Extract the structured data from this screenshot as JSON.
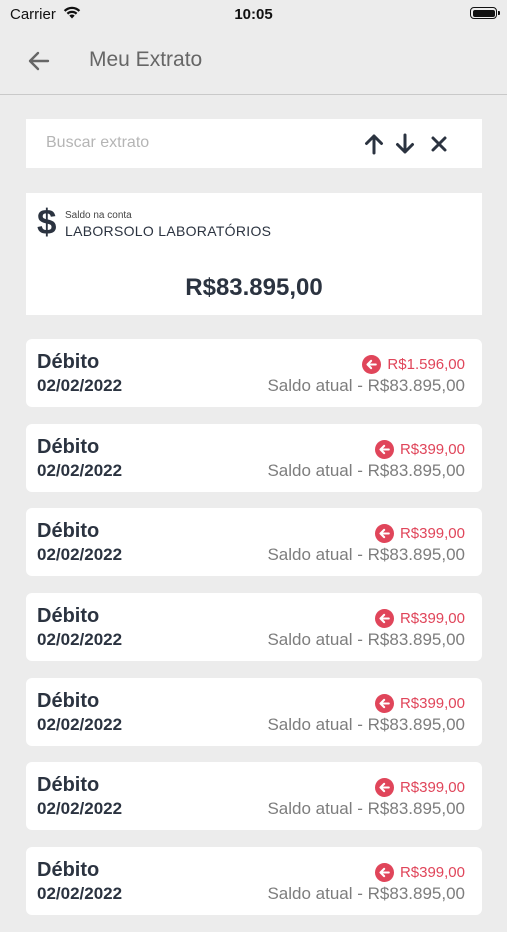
{
  "status_bar": {
    "carrier": "Carrier",
    "time": "10:05"
  },
  "header": {
    "title": "Meu Extrato"
  },
  "search": {
    "placeholder": "Buscar extrato"
  },
  "balance": {
    "caption": "Saldo na conta",
    "company": "LABORSOLO LABORATÓRIOS",
    "amount": "R$83.895,00"
  },
  "transactions": [
    {
      "type": "Débito",
      "date": "02/02/2022",
      "value": "R$1.596,00",
      "balance": "Saldo atual - R$83.895,00"
    },
    {
      "type": "Débito",
      "date": "02/02/2022",
      "value": "R$399,00",
      "balance": "Saldo atual - R$83.895,00"
    },
    {
      "type": "Débito",
      "date": "02/02/2022",
      "value": "R$399,00",
      "balance": "Saldo atual - R$83.895,00"
    },
    {
      "type": "Débito",
      "date": "02/02/2022",
      "value": "R$399,00",
      "balance": "Saldo atual - R$83.895,00"
    },
    {
      "type": "Débito",
      "date": "02/02/2022",
      "value": "R$399,00",
      "balance": "Saldo atual - R$83.895,00"
    },
    {
      "type": "Débito",
      "date": "02/02/2022",
      "value": "R$399,00",
      "balance": "Saldo atual - R$83.895,00"
    },
    {
      "type": "Débito",
      "date": "02/02/2022",
      "value": "R$399,00",
      "balance": "Saldo atual - R$83.895,00"
    }
  ],
  "colors": {
    "debit": "#e0455a",
    "text": "#2b3340",
    "background": "#ececec"
  },
  "icons": {
    "back": "arrow-left-icon",
    "up": "arrow-up-icon",
    "down": "arrow-down-icon",
    "clear": "close-icon",
    "balance": "dollar-icon",
    "debit": "arrow-left-circle-icon"
  }
}
